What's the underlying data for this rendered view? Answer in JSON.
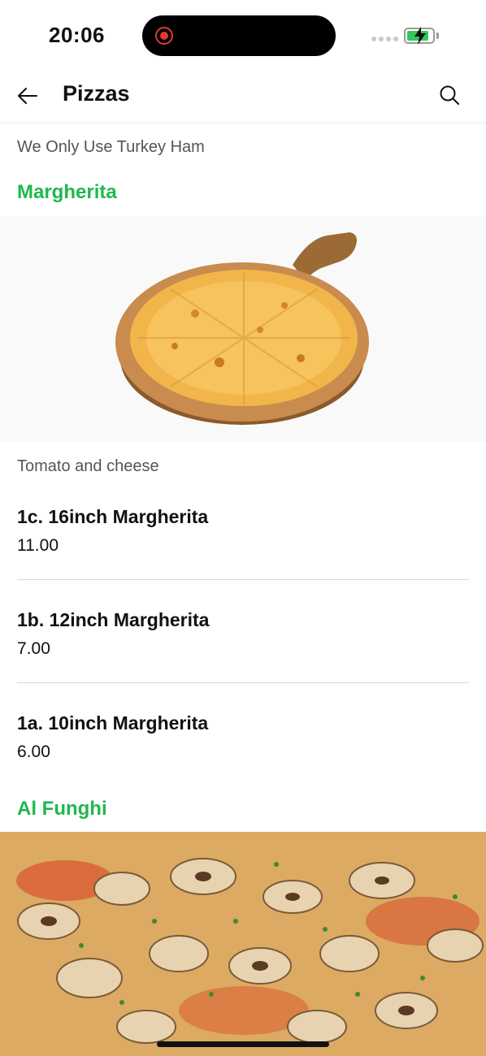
{
  "status_bar": {
    "time": "20:06"
  },
  "header": {
    "title": "Pizzas"
  },
  "notice": "We Only Use Turkey Ham",
  "categories": [
    {
      "title": "Margherita",
      "description": "Tomato and cheese",
      "items": [
        {
          "name": "1c. 16inch Margherita",
          "price": "11.00"
        },
        {
          "name": "1b. 12inch Margherita",
          "price": "7.00"
        },
        {
          "name": "1a. 10inch Margherita",
          "price": "6.00"
        }
      ]
    },
    {
      "title": "Al Funghi"
    }
  ],
  "icons": {
    "back": "arrow-left-icon",
    "search": "search-icon"
  },
  "colors": {
    "accent": "#1fb84f",
    "battery": "#35c759",
    "recording": "#e0392b"
  }
}
